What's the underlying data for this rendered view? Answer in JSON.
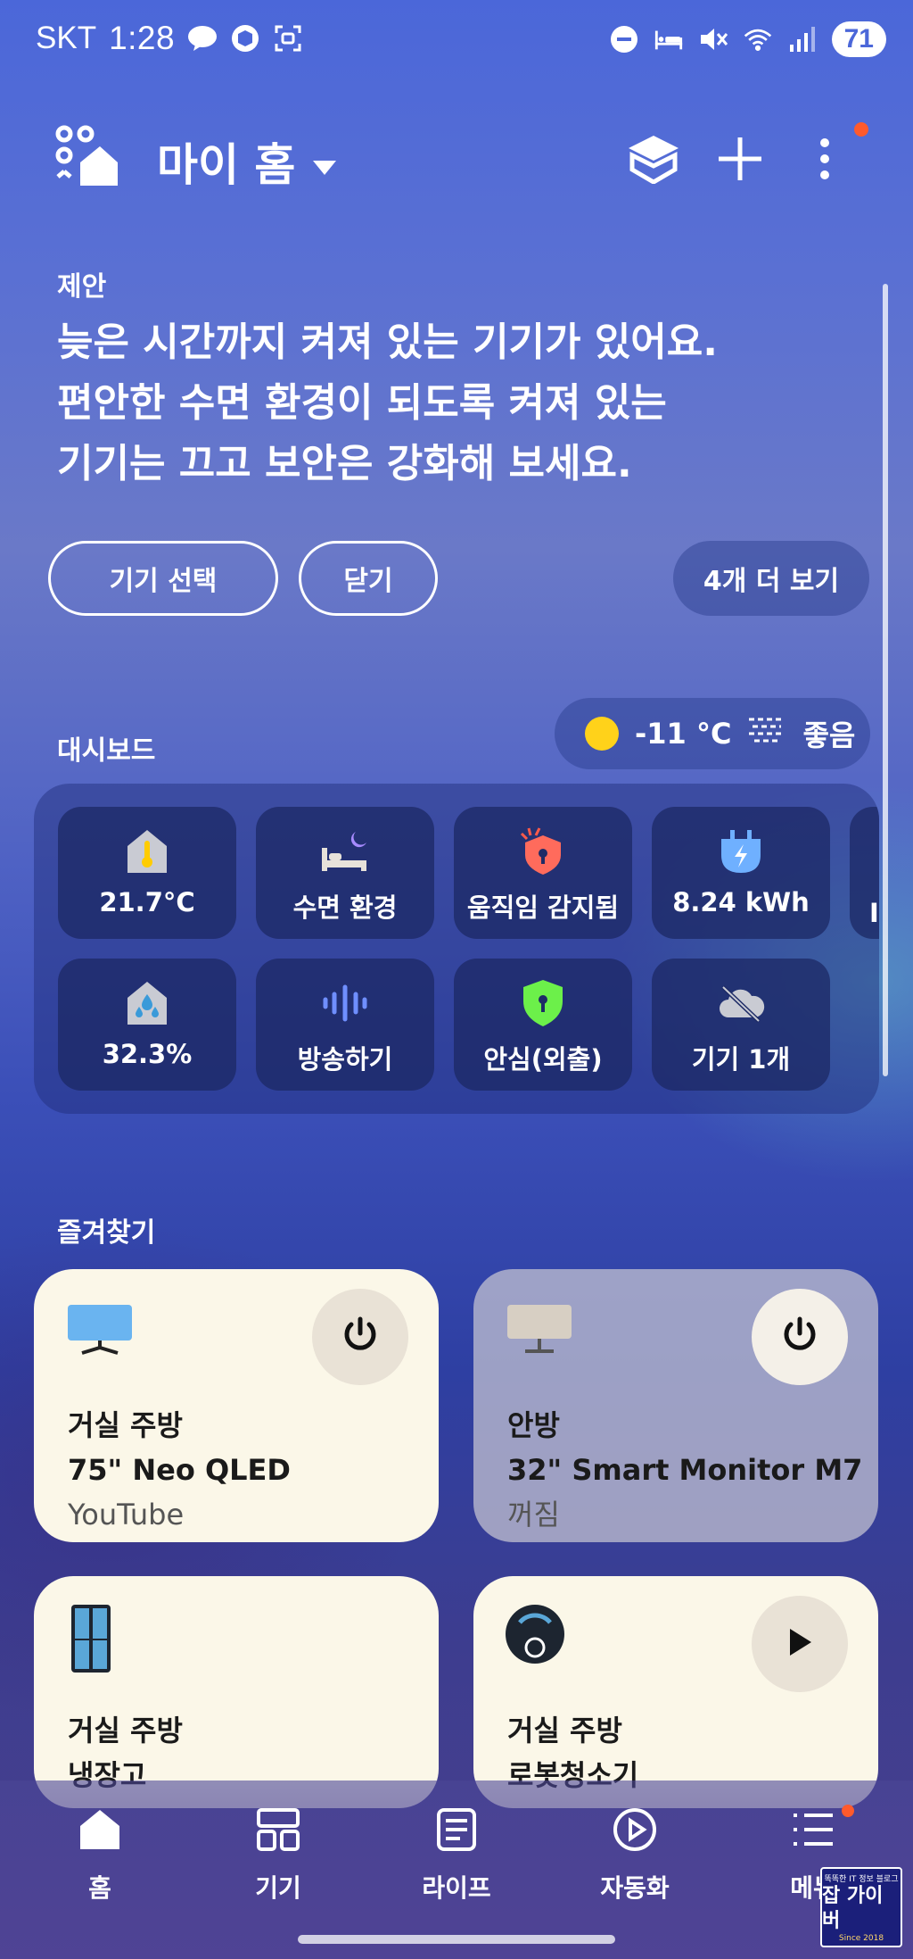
{
  "status_bar": {
    "carrier": "SKT",
    "time": "1:28",
    "battery": "71"
  },
  "header": {
    "title": "마이 홈"
  },
  "suggestion": {
    "label": "제안",
    "line1": "늦은 시간까지 켜져 있는 기기가 있어요.",
    "line2": "편안한 수면 환경이 되도록 켜져 있는",
    "line3": "기기는 끄고 보안은 강화해 보세요.",
    "select_button": "기기 선택",
    "close_button": "닫기",
    "more_button": "4개 더 보기"
  },
  "dashboard": {
    "label": "대시보드",
    "weather": {
      "temperature": "-11 °C",
      "air_quality": "좋음"
    },
    "tiles_row1": [
      {
        "label": "21.7°C",
        "icon": "thermometer-home-icon"
      },
      {
        "label": "수면 환경",
        "icon": "bed-moon-icon"
      },
      {
        "label": "움직임 감지됨",
        "icon": "alert-shield-icon"
      },
      {
        "label": "8.24 kWh",
        "icon": "energy-plug-icon"
      }
    ],
    "tiles_row2": [
      {
        "label": "32.3%",
        "icon": "humidity-home-icon"
      },
      {
        "label": "방송하기",
        "icon": "soundwave-icon"
      },
      {
        "label": "안심(외출)",
        "icon": "lock-shield-icon"
      },
      {
        "label": "기기 1개",
        "icon": "cloud-off-icon"
      }
    ],
    "partial_tile_label": "I"
  },
  "favorites": {
    "label": "즐겨찾기",
    "cards": [
      {
        "room": "거실 주방",
        "device": "75\" Neo QLED",
        "status": "YouTube",
        "icon": "tv-icon",
        "action": "power-icon"
      },
      {
        "room": "안방",
        "device": "32\" Smart Monitor M7",
        "status": "꺼짐",
        "icon": "monitor-icon",
        "action": "power-icon"
      },
      {
        "room": "거실 주방",
        "device": "냉장고",
        "icon": "refrigerator-icon"
      },
      {
        "room": "거실 주방",
        "device": "로봇청소기",
        "icon": "robot-vacuum-icon",
        "action": "play-icon"
      }
    ]
  },
  "bottom_nav": {
    "items": [
      {
        "label": "홈",
        "icon": "home-icon"
      },
      {
        "label": "기기",
        "icon": "devices-icon"
      },
      {
        "label": "라이프",
        "icon": "life-icon"
      },
      {
        "label": "자동화",
        "icon": "automation-icon"
      },
      {
        "label": "메뉴",
        "icon": "menu-icon"
      }
    ]
  },
  "watermark": {
    "top": "똑똑한 IT 정보 블로그",
    "main": "잡 가이버",
    "bottom": "Since 2018"
  },
  "colors": {
    "accent_red": "#ff5a2c",
    "card_light": "#fbf7e8",
    "sun": "#ffd21a",
    "shield_red": "#ff6b5c",
    "shield_green": "#6cf04a",
    "energy_blue": "#6fb0ff"
  }
}
